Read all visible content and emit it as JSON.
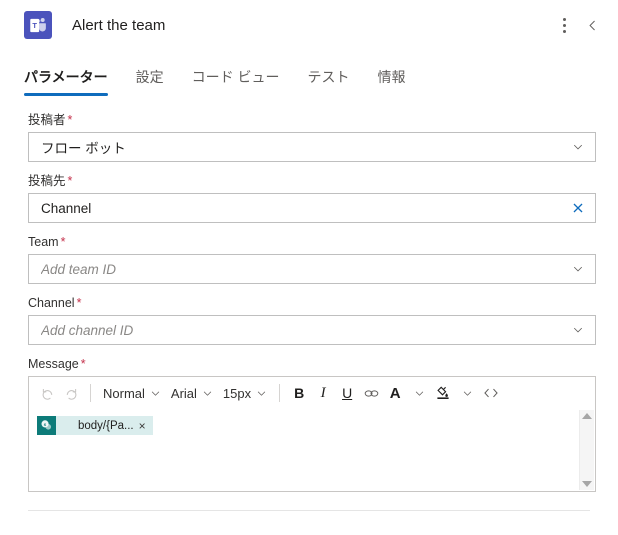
{
  "header": {
    "app_icon": "microsoft-teams-icon",
    "title": "Alert the team",
    "more_icon": "kebab-menu-icon",
    "collapse_icon": "chevron-left-icon"
  },
  "tabs": [
    {
      "label": "パラメーター",
      "active": true
    },
    {
      "label": "設定",
      "active": false
    },
    {
      "label": "コード ビュー",
      "active": false
    },
    {
      "label": "テスト",
      "active": false
    },
    {
      "label": "情報",
      "active": false
    }
  ],
  "colors": {
    "accent": "#0f6cbd",
    "required": "#c4314b",
    "teams_purple": "#4b53bc",
    "token_teal": "#0d7b79",
    "token_bg": "#daeded",
    "clear_blue": "#0f6cbd"
  },
  "fields": {
    "poster": {
      "label": "投稿者",
      "required": "*",
      "value": "フロー ボット",
      "affix_icon": "chevron-down-icon"
    },
    "post_to": {
      "label": "投稿先",
      "required": "*",
      "value": "Channel",
      "affix_icon": "clear-x-icon"
    },
    "team": {
      "label": "Team",
      "required": "*",
      "placeholder": "Add team ID",
      "affix_icon": "chevron-down-icon"
    },
    "channel": {
      "label": "Channel",
      "required": "*",
      "placeholder": "Add channel ID",
      "affix_icon": "chevron-down-icon"
    },
    "message": {
      "label": "Message",
      "required": "*"
    }
  },
  "editor": {
    "toolbar": {
      "undo": {
        "icon": "undo-icon",
        "label": "↺"
      },
      "redo": {
        "icon": "redo-icon",
        "label": "↻"
      },
      "style": "Normal",
      "font": "Arial",
      "size": "15px",
      "bold": "B",
      "italic": "I",
      "underline": "U",
      "link_icon": "link-icon",
      "font_color": "A",
      "highlight_icon": "highlight-color-icon",
      "code_view": "<>"
    },
    "content_token": {
      "icon": "sharepoint-icon",
      "label": "body/{Pa...",
      "remove": "×"
    },
    "scrollbar": {
      "up": "scroll-up-arrow",
      "down": "scroll-down-arrow"
    }
  }
}
